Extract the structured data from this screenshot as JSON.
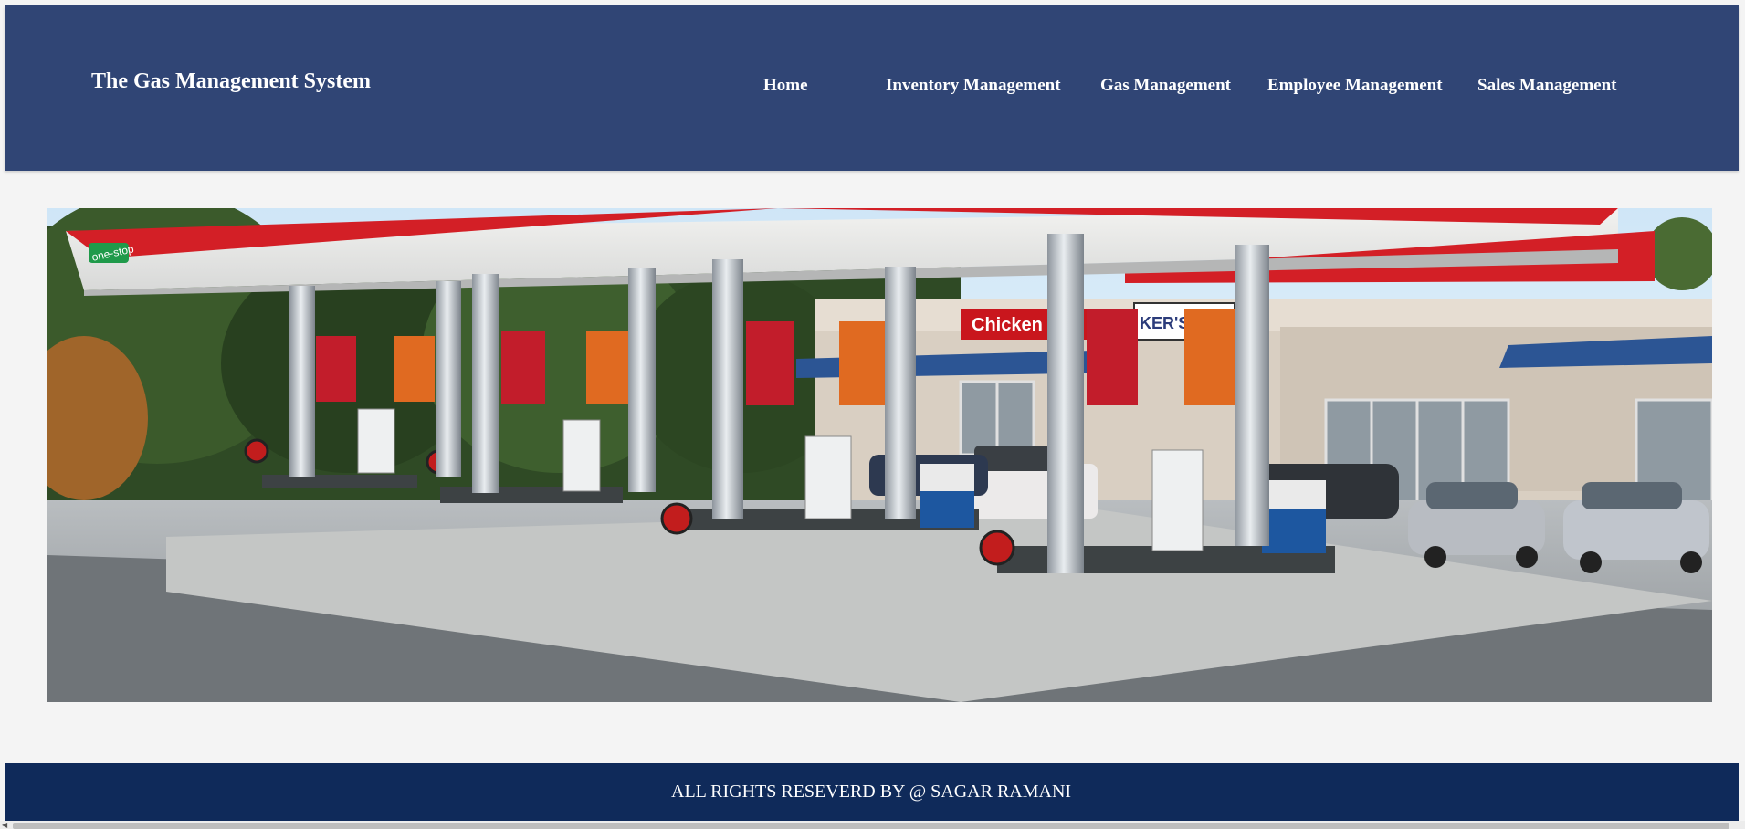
{
  "header": {
    "brand": "The Gas Management System",
    "nav": [
      {
        "label": "Home"
      },
      {
        "label": "Inventory Management"
      },
      {
        "label": "Gas Management"
      },
      {
        "label": "Employee Management"
      },
      {
        "label": "Sales Management"
      }
    ]
  },
  "hero": {
    "signs": {
      "one_stop": "one-stop",
      "chicken_inn": "Chicken inn",
      "kers_inn": "KER'S INN"
    }
  },
  "footer": {
    "text": "ALL RIGHTS RESEVERD BY @ SAGAR RAMANI"
  },
  "colors": {
    "header_bg": "#304575",
    "footer_bg": "#0f2a5a",
    "page_bg": "#f4f4f4"
  }
}
